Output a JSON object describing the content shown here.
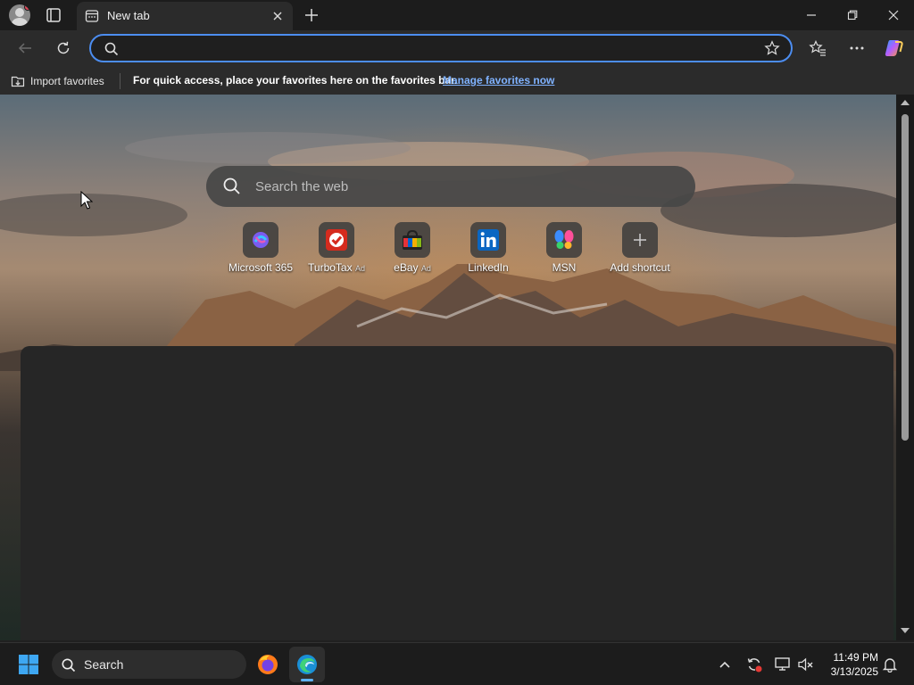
{
  "browser": {
    "tab": {
      "title": "New tab"
    },
    "address": {
      "value": "",
      "placeholder": ""
    },
    "favorites_bar": {
      "import_label": "Import favorites",
      "message": "For quick access, place your favorites here on the favorites bar.",
      "link": "Manage favorites now"
    }
  },
  "newtab": {
    "search_placeholder": "Search the web",
    "shortcuts": [
      {
        "label": "Microsoft 365",
        "ad": ""
      },
      {
        "label": "TurboTax",
        "ad": "Ad"
      },
      {
        "label": "eBay",
        "ad": "Ad"
      },
      {
        "label": "LinkedIn",
        "ad": ""
      },
      {
        "label": "MSN",
        "ad": ""
      },
      {
        "label": "Add shortcut",
        "ad": ""
      }
    ]
  },
  "taskbar": {
    "search_label": "Search",
    "time": "11:49 PM",
    "date": "3/13/2025"
  },
  "colors": {
    "accent": "#4c8df0",
    "link": "#7fb2ff",
    "taskbar_indicator": "#5fb2f2"
  }
}
